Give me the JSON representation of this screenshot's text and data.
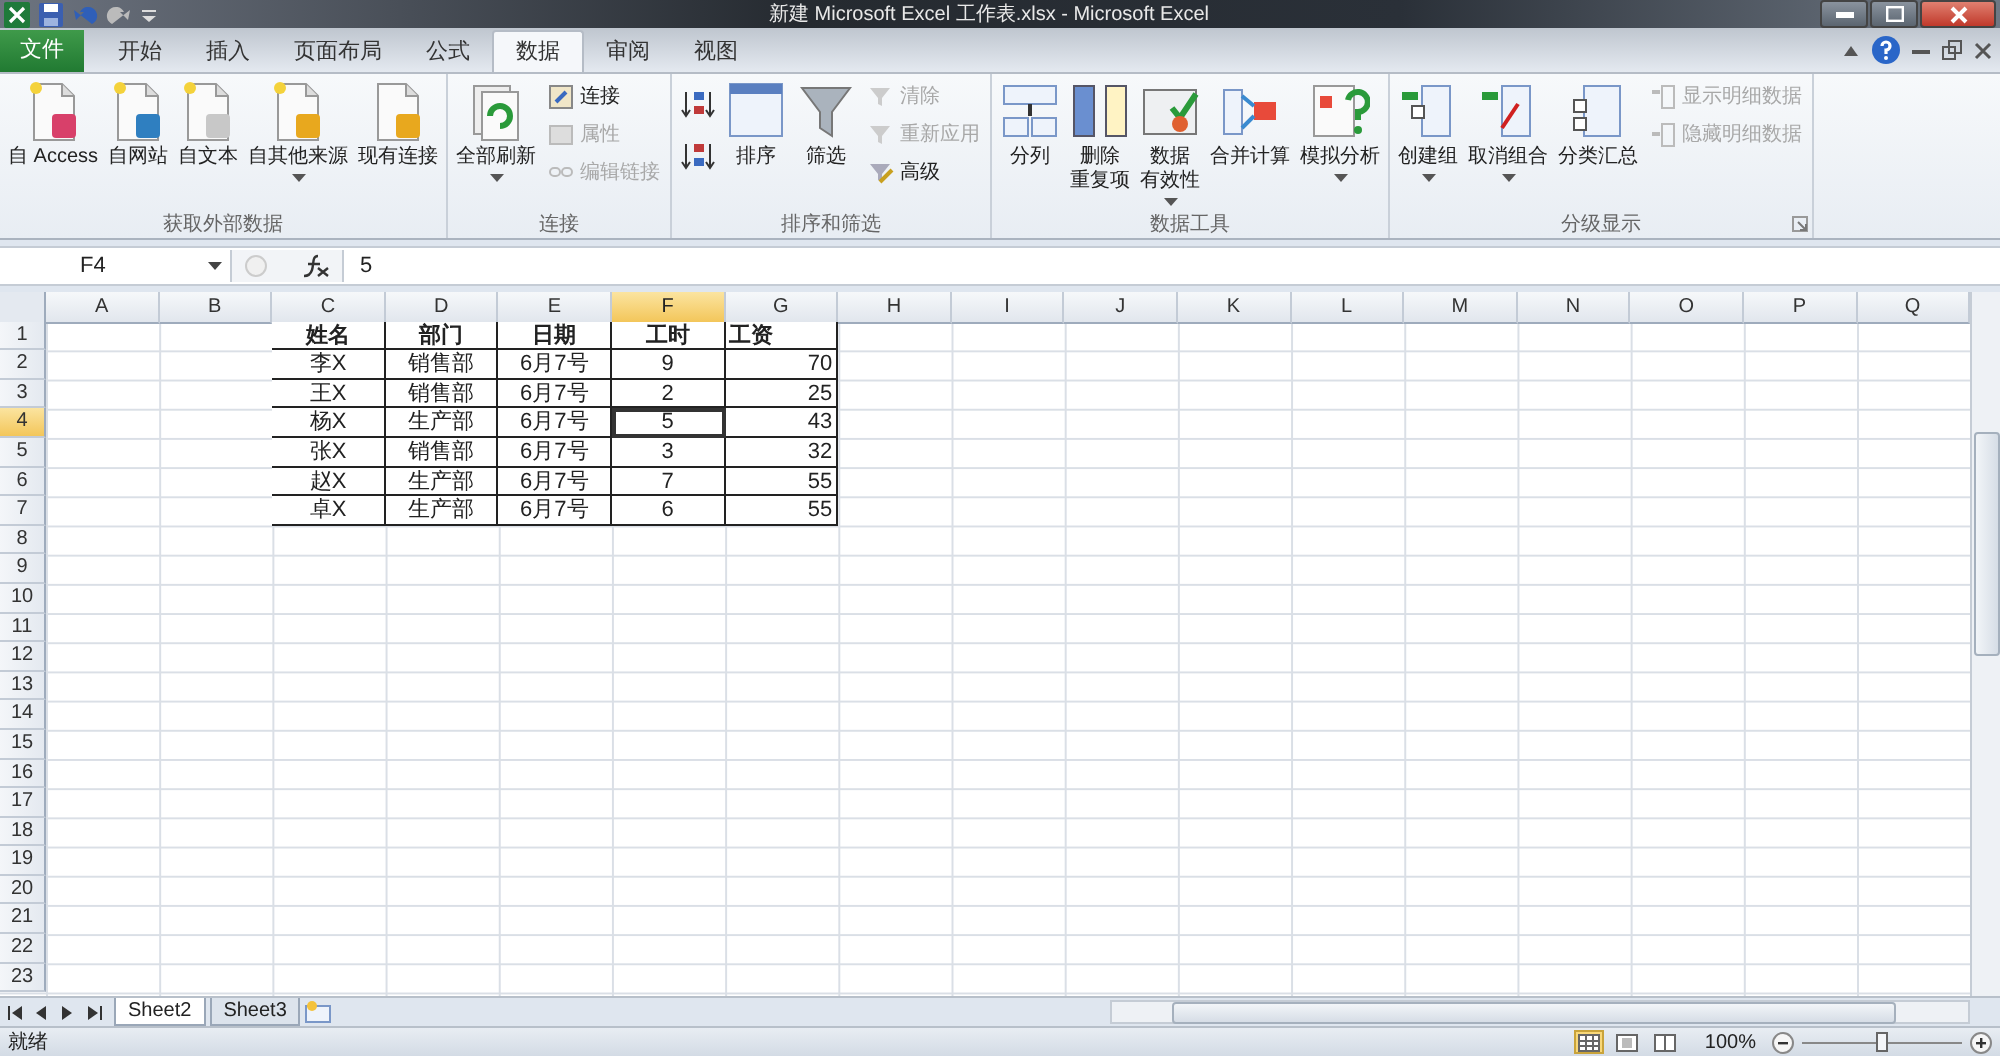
{
  "window": {
    "title": "新建 Microsoft Excel 工作表.xlsx - Microsoft Excel"
  },
  "tabs": [
    {
      "label": "文件",
      "kind": "file",
      "selected": false
    },
    {
      "label": "开始",
      "kind": "tab",
      "selected": false
    },
    {
      "label": "插入",
      "kind": "tab",
      "selected": false
    },
    {
      "label": "页面布局",
      "kind": "tab",
      "selected": false
    },
    {
      "label": "公式",
      "kind": "tab",
      "selected": false
    },
    {
      "label": "数据",
      "kind": "tab",
      "selected": true
    },
    {
      "label": "审阅",
      "kind": "tab",
      "selected": false
    },
    {
      "label": "视图",
      "kind": "tab",
      "selected": false
    }
  ],
  "ribbon": {
    "groups": [
      {
        "title": "获取外部数据",
        "launcher": false,
        "buttons": [
          {
            "label": "自 Access",
            "kind": "large",
            "disabled": false,
            "dropdown": false
          },
          {
            "label": "自网站",
            "kind": "large",
            "disabled": false,
            "dropdown": false
          },
          {
            "label": "自文本",
            "kind": "large",
            "disabled": false,
            "dropdown": false
          },
          {
            "label": "自其他来源",
            "kind": "large",
            "disabled": false,
            "dropdown": true
          },
          {
            "label": "现有连接",
            "kind": "large",
            "disabled": false,
            "dropdown": false
          }
        ]
      },
      {
        "title": "连接",
        "launcher": false,
        "buttons": [
          {
            "label": "全部刷新",
            "kind": "large",
            "disabled": false,
            "dropdown": true
          },
          {
            "label": "连接",
            "kind": "small",
            "disabled": false,
            "dropdown": false
          },
          {
            "label": "属性",
            "kind": "small",
            "disabled": true,
            "dropdown": false
          },
          {
            "label": "编辑链接",
            "kind": "small",
            "disabled": true,
            "dropdown": false
          }
        ]
      },
      {
        "title": "排序和筛选",
        "launcher": false,
        "buttons": [
          {
            "kind": "icon"
          },
          {
            "kind": "icon"
          },
          {
            "label": "排序",
            "kind": "large",
            "disabled": false,
            "dropdown": false
          },
          {
            "label": "筛选",
            "kind": "large",
            "disabled": false,
            "dropdown": false
          },
          {
            "label": "清除",
            "kind": "small",
            "disabled": true,
            "dropdown": false
          },
          {
            "label": "重新应用",
            "kind": "small",
            "disabled": true,
            "dropdown": false
          },
          {
            "label": "高级",
            "kind": "small",
            "disabled": false,
            "dropdown": false
          }
        ]
      },
      {
        "title": "数据工具",
        "launcher": false,
        "buttons": [
          {
            "label": "分列",
            "kind": "large",
            "disabled": false,
            "dropdown": false
          },
          {
            "label": [
              "删除",
              "重复项"
            ],
            "kind": "large",
            "disabled": false,
            "dropdown": false
          },
          {
            "label": [
              "数据",
              "有效性"
            ],
            "kind": "large",
            "disabled": false,
            "dropdown": true
          },
          {
            "label": "合并计算",
            "kind": "large",
            "disabled": false,
            "dropdown": false
          },
          {
            "label": "模拟分析",
            "kind": "large",
            "disabled": false,
            "dropdown": true
          }
        ]
      },
      {
        "title": "分级显示",
        "launcher": true,
        "buttons": [
          {
            "label": "创建组",
            "kind": "large",
            "disabled": false,
            "dropdown": true
          },
          {
            "label": "取消组合",
            "kind": "large",
            "disabled": false,
            "dropdown": true
          },
          {
            "label": "分类汇总",
            "kind": "large",
            "disabled": false,
            "dropdown": false
          },
          {
            "label": "显示明细数据",
            "kind": "small",
            "disabled": true,
            "dropdown": false
          },
          {
            "label": "隐藏明细数据",
            "kind": "small",
            "disabled": true,
            "dropdown": false
          }
        ]
      }
    ]
  },
  "name_box": "F4",
  "formula": "5",
  "columns": [
    {
      "label": "A",
      "selected": false
    },
    {
      "label": "B",
      "selected": false
    },
    {
      "label": "C",
      "selected": false
    },
    {
      "label": "D",
      "selected": false
    },
    {
      "label": "E",
      "selected": false
    },
    {
      "label": "F",
      "selected": true
    },
    {
      "label": "G",
      "selected": false
    },
    {
      "label": "H",
      "selected": false
    },
    {
      "label": "I",
      "selected": false
    },
    {
      "label": "J",
      "selected": false
    },
    {
      "label": "K",
      "selected": false
    },
    {
      "label": "L",
      "selected": false
    },
    {
      "label": "M",
      "selected": false
    },
    {
      "label": "N",
      "selected": false
    },
    {
      "label": "O",
      "selected": false
    },
    {
      "label": "P",
      "selected": false
    },
    {
      "label": "Q",
      "selected": false
    }
  ],
  "rows": [
    {
      "label": "1",
      "selected": false
    },
    {
      "label": "2",
      "selected": false
    },
    {
      "label": "3",
      "selected": false
    },
    {
      "label": "4",
      "selected": true
    },
    {
      "label": "5",
      "selected": false
    },
    {
      "label": "6",
      "selected": false
    },
    {
      "label": "7",
      "selected": false
    },
    {
      "label": "8",
      "selected": false
    },
    {
      "label": "9",
      "selected": false
    },
    {
      "label": "10",
      "selected": false
    },
    {
      "label": "11",
      "selected": false
    },
    {
      "label": "12",
      "selected": false
    },
    {
      "label": "13",
      "selected": false
    },
    {
      "label": "14",
      "selected": false
    },
    {
      "label": "15",
      "selected": false
    },
    {
      "label": "16",
      "selected": false
    },
    {
      "label": "17",
      "selected": false
    },
    {
      "label": "18",
      "selected": false
    },
    {
      "label": "19",
      "selected": false
    },
    {
      "label": "20",
      "selected": false
    },
    {
      "label": "21",
      "selected": false
    },
    {
      "label": "22",
      "selected": false
    },
    {
      "label": "23",
      "selected": false
    }
  ],
  "table": {
    "header": [
      "姓名",
      "部门",
      "日期",
      "工时",
      "工资"
    ],
    "rows": [
      [
        "李X",
        "销售部",
        "6月7号",
        "9",
        "70"
      ],
      [
        "王X",
        "销售部",
        "6月7号",
        "2",
        "25"
      ],
      [
        "杨X",
        "生产部",
        "6月7号",
        "5",
        "43"
      ],
      [
        "张X",
        "销售部",
        "6月7号",
        "3",
        "32"
      ],
      [
        "赵X",
        "生产部",
        "6月7号",
        "7",
        "55"
      ],
      [
        "卓X",
        "生产部",
        "6月7号",
        "6",
        "55"
      ]
    ]
  },
  "sheet_tabs": [
    {
      "label": "Sheet2",
      "selected": true
    },
    {
      "label": "Sheet3",
      "selected": false
    }
  ],
  "status_bar": {
    "status": "就绪",
    "zoom": "100%",
    "zoom_level": {
      "level": 0.5
    }
  }
}
